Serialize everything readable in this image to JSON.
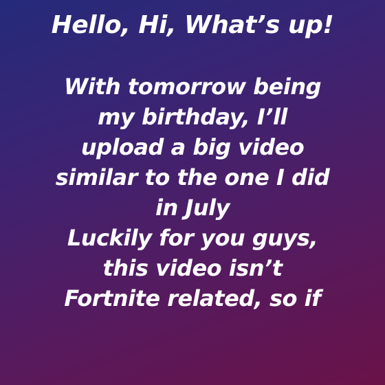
{
  "story": {
    "headline": "Hello, Hi, What’s up!",
    "lines": [
      "With tomorrow being",
      "my birthday, I’ll",
      "upload a big video",
      "similar to the one I did",
      "in July",
      "Luckily for you guys,",
      "this video isn’t",
      "Fortnite related, so if"
    ],
    "text_color": "#ffffff",
    "background_colors": [
      "#252a7a",
      "#3a2474",
      "#521c62",
      "#6a1248"
    ]
  }
}
